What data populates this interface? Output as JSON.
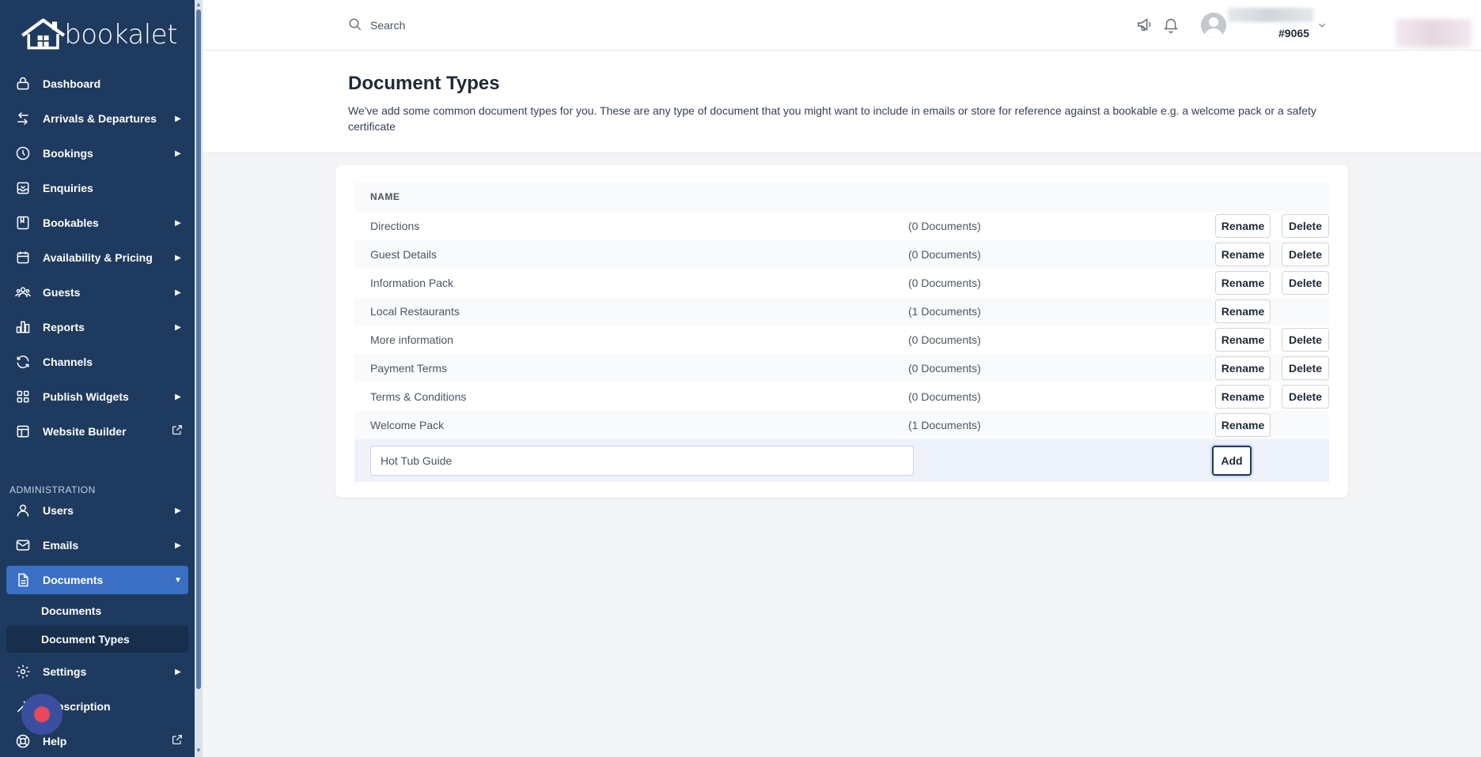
{
  "brand": {
    "name": "bookalet"
  },
  "sidebar": {
    "items": [
      {
        "label": "Dashboard",
        "icon": "lock-icon"
      },
      {
        "label": "Arrivals & Departures",
        "icon": "arrows-icon"
      },
      {
        "label": "Bookings",
        "icon": "clock-icon"
      },
      {
        "label": "Enquiries",
        "icon": "inbox-icon"
      },
      {
        "label": "Bookables",
        "icon": "book-icon"
      },
      {
        "label": "Availability & Pricing",
        "icon": "calendar-icon"
      },
      {
        "label": "Guests",
        "icon": "users-icon"
      },
      {
        "label": "Reports",
        "icon": "chart-icon"
      },
      {
        "label": "Channels",
        "icon": "refresh-icon"
      },
      {
        "label": "Publish Widgets",
        "icon": "grid-icon"
      },
      {
        "label": "Website Builder",
        "icon": "layout-icon"
      }
    ],
    "admin_label": "ADMINISTRATION",
    "admin_items": [
      {
        "label": "Users",
        "icon": "user-icon"
      },
      {
        "label": "Emails",
        "icon": "mail-icon"
      },
      {
        "label": "Documents",
        "icon": "document-icon"
      }
    ],
    "documents_sub": [
      {
        "label": "Documents"
      },
      {
        "label": "Document Types"
      }
    ],
    "bottom_items": [
      {
        "label": "Settings",
        "icon": "gear-icon"
      },
      {
        "label": "Subscription",
        "icon": "wand-icon"
      },
      {
        "label": "Help",
        "icon": "lifebuoy-icon"
      }
    ]
  },
  "topbar": {
    "search_placeholder": "Search",
    "user_id": "#9065"
  },
  "page": {
    "title": "Document Types",
    "description": "We've add some common document types for you. These are any type of document that you might want to include in emails or store for reference against a bookable e.g. a welcome pack or a safety certificate"
  },
  "table": {
    "header": "NAME",
    "rename_label": "Rename",
    "delete_label": "Delete",
    "rows": [
      {
        "name": "Directions",
        "count": "(0 Documents)",
        "deletable": true
      },
      {
        "name": "Guest Details",
        "count": "(0 Documents)",
        "deletable": true
      },
      {
        "name": "Information Pack",
        "count": "(0 Documents)",
        "deletable": true
      },
      {
        "name": "Local Restaurants",
        "count": "(1 Documents)",
        "deletable": false
      },
      {
        "name": "More information",
        "count": "(0 Documents)",
        "deletable": true
      },
      {
        "name": "Payment Terms",
        "count": "(0 Documents)",
        "deletable": true
      },
      {
        "name": "Terms & Conditions",
        "count": "(0 Documents)",
        "deletable": true
      },
      {
        "name": "Welcome Pack",
        "count": "(1 Documents)",
        "deletable": false
      }
    ],
    "new_value": "Hot Tub Guide",
    "add_label": "Add"
  }
}
